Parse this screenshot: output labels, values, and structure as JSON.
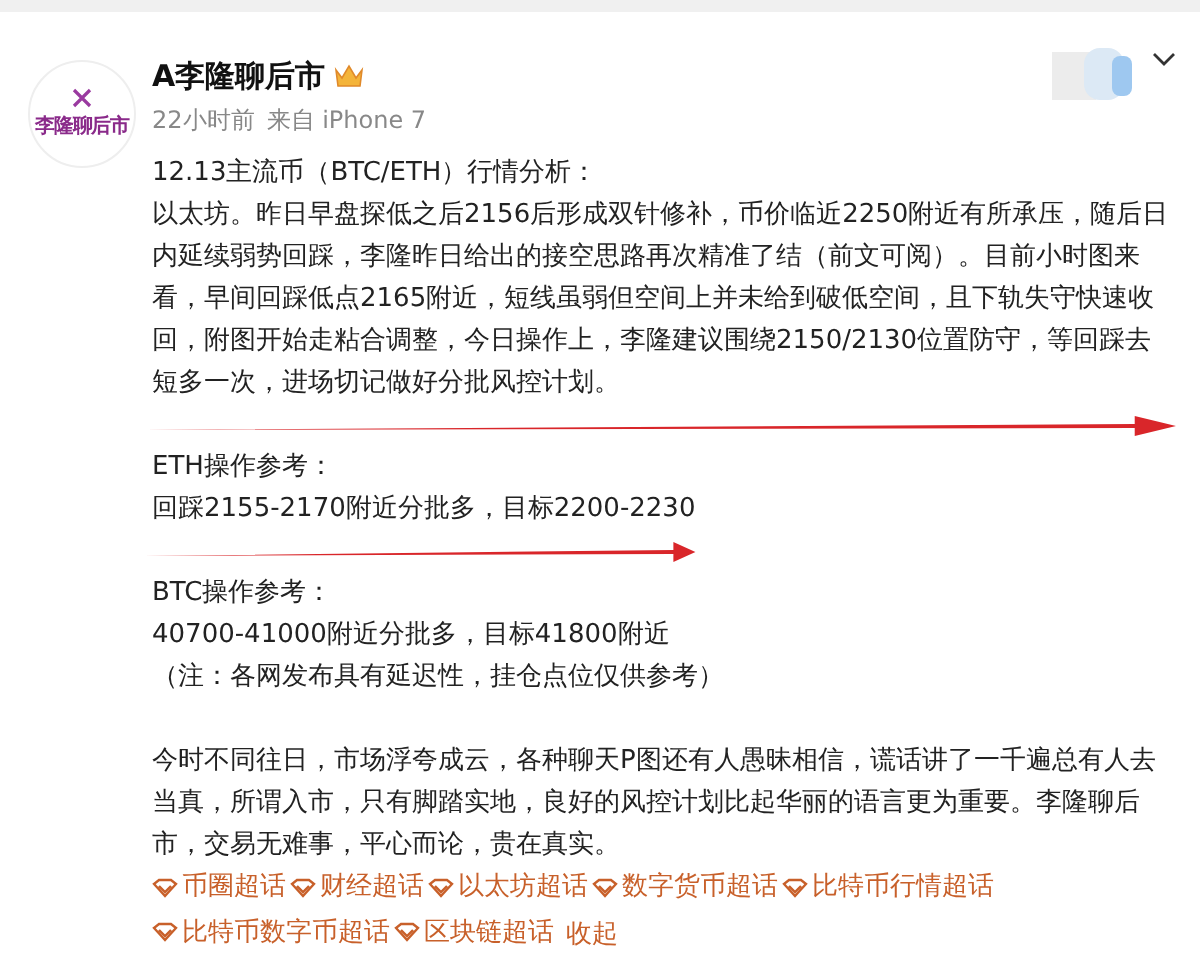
{
  "post": {
    "avatar": {
      "label": "李隆聊后市"
    },
    "author": "A李隆聊后市",
    "time": "22小时前",
    "source": "来自 iPhone 7",
    "blocks": [
      {
        "lines": [
          "12.13主流币（BTC/ETH）行情分析：",
          "以太坊。昨日早盘探低之后2156后形成双针修补，币价临近2250附近有所承压，随后日内延续弱势回踩，李隆昨日给出的接空思路再次精准了结（前文可阅）。目前小时图来看，早间回踩低点2165附近，短线虽弱但空间上并未给到破低空间，且下轨失守快速收回，附图开始走粘合调整，今日操作上，李隆建议围绕2150/2130位置防守，等回踩去短多一次，进场切记做好分批风控计划。"
        ],
        "arrow": true
      },
      {
        "lines": [
          "ETH操作参考：",
          "回踩2155-2170附近分批多，目标2200-2230"
        ],
        "arrow": true
      },
      {
        "lines": [
          "BTC操作参考：",
          "40700-41000附近分批多，目标41800附近",
          "（注：各网发布具有延迟性，挂仓点位仅供参考）"
        ],
        "arrow": false
      }
    ],
    "closing": {
      "text": "今时不同往日，市场浮夸成云，各种聊天P图还有人愚昧相信，谎话讲了一千遍总有人去当真，所谓入市，只有脚踏实地，良好的风控计划比起华丽的语言更为重要。李隆聊后市，交易无难事，平心而论，贵在真实。",
      "topics": [
        "币圈超话",
        "财经超话",
        "以太坊超话",
        "数字货币超话",
        "比特币行情超话",
        "比特币数字币超话",
        "区块链超话"
      ],
      "collapse": "收起"
    }
  }
}
